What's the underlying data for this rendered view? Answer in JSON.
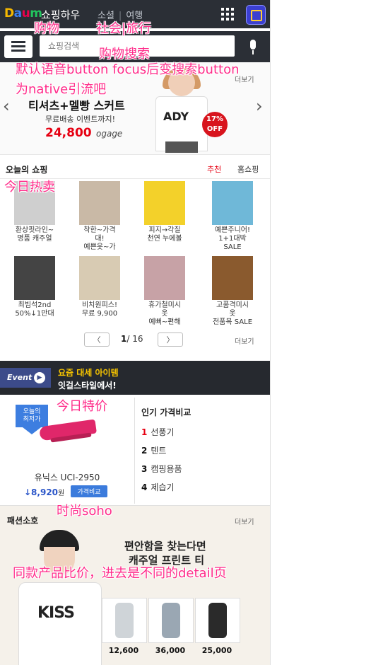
{
  "header": {
    "logo": [
      "D",
      "a",
      "u",
      "m"
    ],
    "app_title": "쇼핑하우",
    "nav": [
      "소셜",
      "여행"
    ]
  },
  "search": {
    "placeholder": "쇼핑검색"
  },
  "banner": {
    "headline": "티셔츠+멜빵 스커트",
    "sub": "무료배송 이벤트까지!",
    "price": "24,800",
    "brand": "ogage",
    "shirt_text": "ADY",
    "badge": "17% OFF",
    "more": "더보기"
  },
  "today": {
    "title": "오늘의 쇼핑",
    "tabs": [
      "추천",
      "홈쇼핑"
    ],
    "items": [
      {
        "name": "환상핏라인~\n명품 캐주얼",
        "color": "#cfcfcf"
      },
      {
        "name": "착한~가격\n대!\n예쁜옷~가",
        "color": "#c9b9a6"
      },
      {
        "name": "피지→각질\n천연 누에볼",
        "color": "#f3d12a"
      },
      {
        "name": "예쁜주니어!\n1+1대박\nSALE",
        "color": "#6fb8d8"
      },
      {
        "name": "최빔석2nd\n50%↓1만대",
        "color": "#444444"
      },
      {
        "name": "비치원피스!\n무료 9,900",
        "color": "#d8cbb3"
      },
      {
        "name": "휴가철미시\n옷\n예뻐~편해",
        "color": "#c7a2a6"
      },
      {
        "name": "고품격미시\n옷\n전품목 SALE",
        "color": "#8a5a2e"
      }
    ],
    "pager": {
      "current": "1",
      "total": "/ 16",
      "prev": "〈",
      "next": "〉"
    },
    "more": "더보기"
  },
  "event": {
    "badge": "Event",
    "line1": "요즘 대세 아이템",
    "line2": "잇걸스타일에서!"
  },
  "deal": {
    "tag": "오늘의\n최저가",
    "name": "유닉스 UCI-2950",
    "price": "↓8,920",
    "unit": "원",
    "compare": "가격비교"
  },
  "rank": {
    "title": "인기 가격비교",
    "items": [
      {
        "num": "1",
        "label": "선풍기"
      },
      {
        "num": "2",
        "label": "텐트"
      },
      {
        "num": "3",
        "label": "캠핑용품"
      },
      {
        "num": "4",
        "label": "제습기"
      }
    ]
  },
  "soho": {
    "title": "패션소호",
    "more": "더보기",
    "line1": "편안함을 찾는다면",
    "line2": "캐주얼 프린트 티",
    "tee": "KISS",
    "thumbs": [
      {
        "price": "12,600",
        "color": "#cfd4d8"
      },
      {
        "price": "36,000",
        "color": "#9aa7b3"
      },
      {
        "price": "25,000",
        "color": "#2a2a2a"
      }
    ]
  },
  "annotations": {
    "shopping": "购物",
    "social_travel": "社会|旅行",
    "search": "购物搜索",
    "voice": "默认语音button focus后变搜索button",
    "native": "为native引流吧",
    "hot": "今日热卖",
    "deal": "今日特价",
    "soho": "时尚soho",
    "compare": "同款产品比价，进去是不同的detail页"
  }
}
